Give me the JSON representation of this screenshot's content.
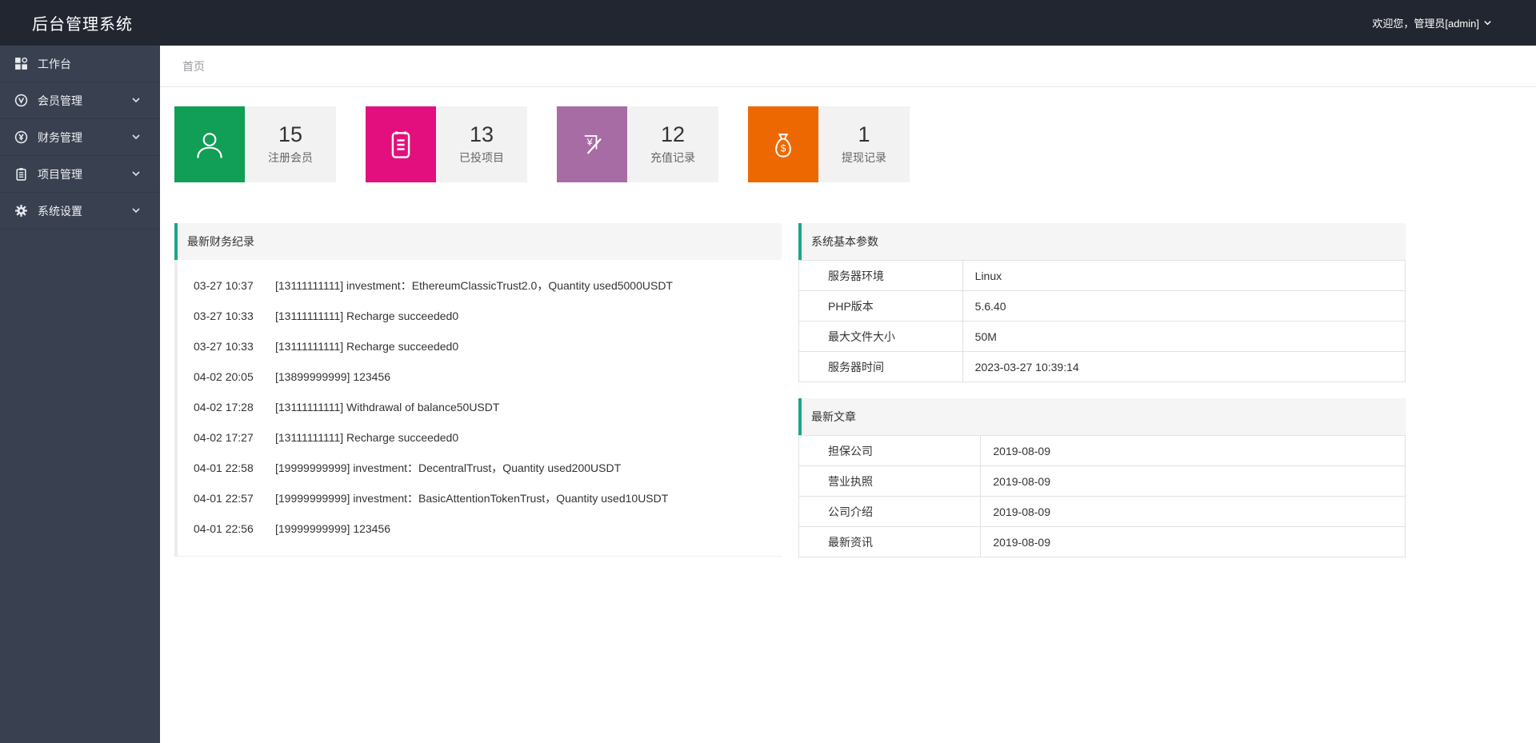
{
  "header": {
    "title": "后台管理系统",
    "welcome": "欢迎您，管理员[admin]"
  },
  "sidebar": {
    "items": [
      {
        "label": "工作台",
        "icon": "dashboard-icon",
        "expandable": false
      },
      {
        "label": "会员管理",
        "icon": "members-icon",
        "expandable": true
      },
      {
        "label": "财务管理",
        "icon": "finance-icon",
        "expandable": true
      },
      {
        "label": "项目管理",
        "icon": "projects-icon",
        "expandable": true
      },
      {
        "label": "系统设置",
        "icon": "settings-icon",
        "expandable": true
      }
    ]
  },
  "breadcrumb": {
    "current": "首页"
  },
  "stats": {
    "cards": [
      {
        "value": "15",
        "label": "注册会员",
        "color": "#119e56",
        "icon": "user-icon"
      },
      {
        "value": "13",
        "label": "已投项目",
        "color": "#e40f7e",
        "icon": "clipboard-icon"
      },
      {
        "value": "12",
        "label": "充值记录",
        "color": "#a76ca3",
        "icon": "yen-card-icon"
      },
      {
        "value": "1",
        "label": "提现记录",
        "color": "#ee6801",
        "icon": "money-bag-icon"
      }
    ]
  },
  "finance_panel": {
    "title": "最新财务纪录",
    "records": [
      {
        "time": "03-27 10:37",
        "text": "[13111111111] investment：EthereumClassicTrust2.0，Quantity used5000USDT"
      },
      {
        "time": "03-27 10:33",
        "text": "[13111111111] Recharge succeeded0"
      },
      {
        "time": "03-27 10:33",
        "text": "[13111111111] Recharge succeeded0"
      },
      {
        "time": "04-02 20:05",
        "text": "[13899999999] 123456"
      },
      {
        "time": "04-02 17:28",
        "text": "[13111111111] Withdrawal of balance50USDT"
      },
      {
        "time": "04-02 17:27",
        "text": "[13111111111] Recharge succeeded0"
      },
      {
        "time": "04-01 22:58",
        "text": "[19999999999] investment：DecentralTrust，Quantity used200USDT"
      },
      {
        "time": "04-01 22:57",
        "text": "[19999999999] investment：BasicAttentionTokenTrust，Quantity used10USDT"
      },
      {
        "time": "04-01 22:56",
        "text": "[19999999999] 123456"
      }
    ]
  },
  "system_panel": {
    "title": "系统基本参数",
    "rows": [
      {
        "label": "服务器环境",
        "value": "Linux"
      },
      {
        "label": "PHP版本",
        "value": "5.6.40"
      },
      {
        "label": "最大文件大小",
        "value": "50M"
      },
      {
        "label": "服务器时间",
        "value": "2023-03-27 10:39:14"
      }
    ]
  },
  "articles_panel": {
    "title": "最新文章",
    "rows": [
      {
        "label": "担保公司",
        "value": "2019-08-09"
      },
      {
        "label": "营业执照",
        "value": "2019-08-09"
      },
      {
        "label": "公司介绍",
        "value": "2019-08-09"
      },
      {
        "label": "最新资讯",
        "value": "2019-08-09"
      }
    ]
  },
  "colors": {
    "accent_teal": "#18a689",
    "topbar_bg": "#222631",
    "sidebar_bg": "#394150",
    "card_meta_bg": "#f2f2f2"
  }
}
